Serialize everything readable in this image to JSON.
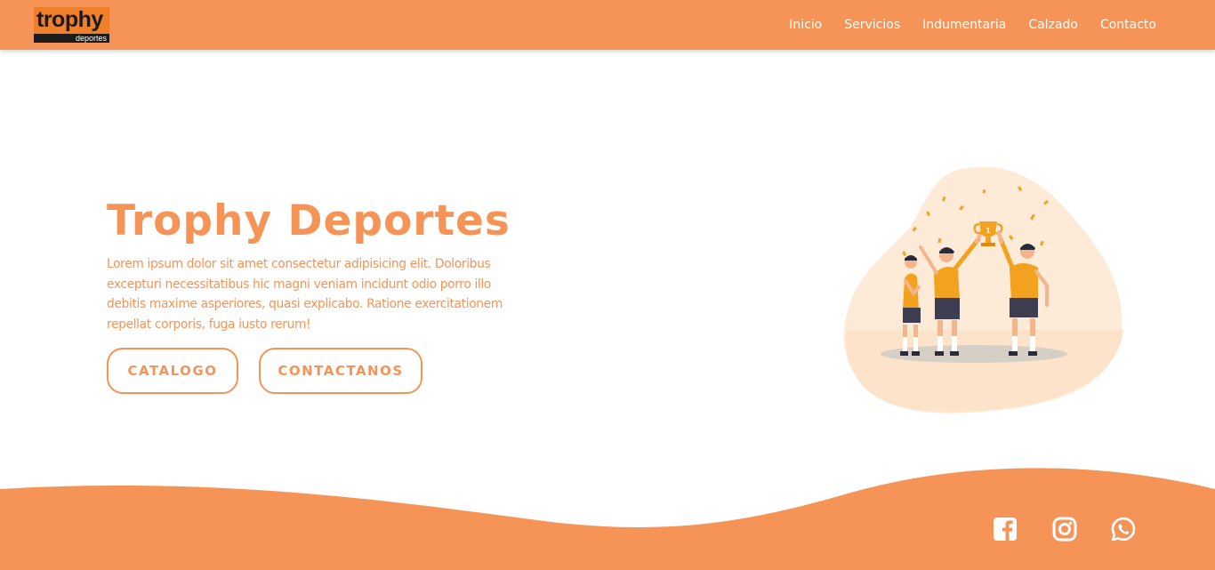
{
  "brand": {
    "logo_top": "trophy",
    "logo_bottom": "deportes",
    "color": "#f59456"
  },
  "nav": {
    "items": [
      {
        "label": "Inicio"
      },
      {
        "label": "Servicios"
      },
      {
        "label": "Indumentaria"
      },
      {
        "label": "Calzado"
      },
      {
        "label": "Contacto"
      }
    ]
  },
  "hero": {
    "title": "Trophy Deportes",
    "description": "Lorem ipsum dolor sit amet consectetur adipisicing elit. Doloribus excepturi necessitatibus hic magni veniam incidunt odio porro illo debitis maxime asperiores, quasi explicabo. Ratione exercitationem repellat corporis, fuga iusto rerum!",
    "buttons": {
      "catalog": "CATALOGO",
      "contact": "CONTACTANOS"
    },
    "illustration": "team-trophy-celebration"
  },
  "footer": {
    "social": [
      {
        "icon": "facebook-icon"
      },
      {
        "icon": "instagram-icon"
      },
      {
        "icon": "whatsapp-icon"
      }
    ]
  }
}
